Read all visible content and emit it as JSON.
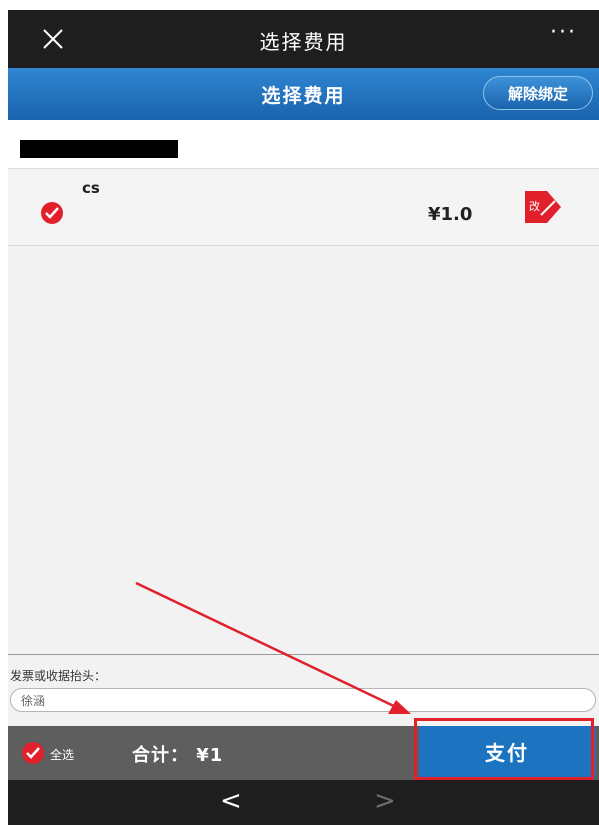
{
  "topbar": {
    "title": "选择费用",
    "more": "···"
  },
  "header": {
    "title": "选择费用",
    "unbind_label": "解除绑定"
  },
  "fee_items": [
    {
      "name": "cs",
      "price": "¥1.0",
      "edit_icon_text": "改"
    }
  ],
  "invoice": {
    "label": "发票或收据抬头：",
    "value": "徐涵"
  },
  "bottom_bar": {
    "select_all_label": "全选",
    "total_text": "合计： ¥1",
    "pay_label": "支付"
  },
  "nav": {
    "back": "<",
    "forward": ">"
  },
  "colors": {
    "header_blue": "#1a63ad",
    "check_red": "#e0202a",
    "pay_blue": "#1c74c0",
    "annotation_red": "#e0202a"
  }
}
